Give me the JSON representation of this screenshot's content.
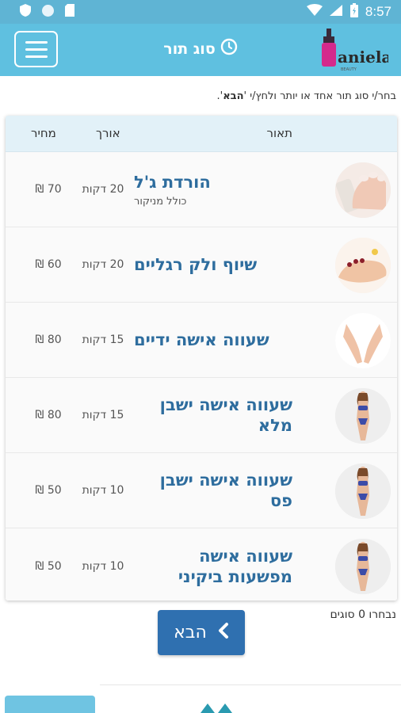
{
  "status_bar": {
    "time": "8:57"
  },
  "header": {
    "title": "סוג תור"
  },
  "logo": {
    "text": "Daniela",
    "tagline": "BEAUTY"
  },
  "instructions": {
    "prefix": "בחר/י סוג תור אחד או יותר ולחץ/י '",
    "highlight": "הבא",
    "suffix": "'."
  },
  "table": {
    "columns": {
      "description": "תאור",
      "length": "אורך",
      "price": "מחיר"
    },
    "rows": [
      {
        "name": "הורדת ג'ל",
        "sub": "כולל מניקור",
        "length": "20 דקות",
        "price": "70 ₪",
        "image": "manicure-hand"
      },
      {
        "name": "שיוף ולק רגליים",
        "sub": "",
        "length": "20 דקות",
        "price": "60 ₪",
        "image": "pedicure-feet"
      },
      {
        "name": "שעווה אישה ידיים",
        "sub": "",
        "length": "15 דקות",
        "price": "80 ₪",
        "image": "hands"
      },
      {
        "name": "שעווה אישה ישבן מלא",
        "sub": "",
        "length": "15 דקות",
        "price": "80 ₪",
        "image": "bikini-woman"
      },
      {
        "name": "שעווה אישה ישבן פס",
        "sub": "",
        "length": "10 דקות",
        "price": "50 ₪",
        "image": "bikini-woman"
      },
      {
        "name": "שעווה אישה מפשעות ביקיני",
        "sub": "",
        "length": "10 דקות",
        "price": "50 ₪",
        "image": "bikini-woman"
      }
    ]
  },
  "selection": {
    "count_text": "נבחרו 0 סוגים"
  },
  "next_button": {
    "label": "הבא"
  },
  "colors": {
    "primary": "#5fc0e0",
    "button": "#2f70b0",
    "name_text": "#2e6d9e",
    "header_row": "#e2f1f8"
  }
}
